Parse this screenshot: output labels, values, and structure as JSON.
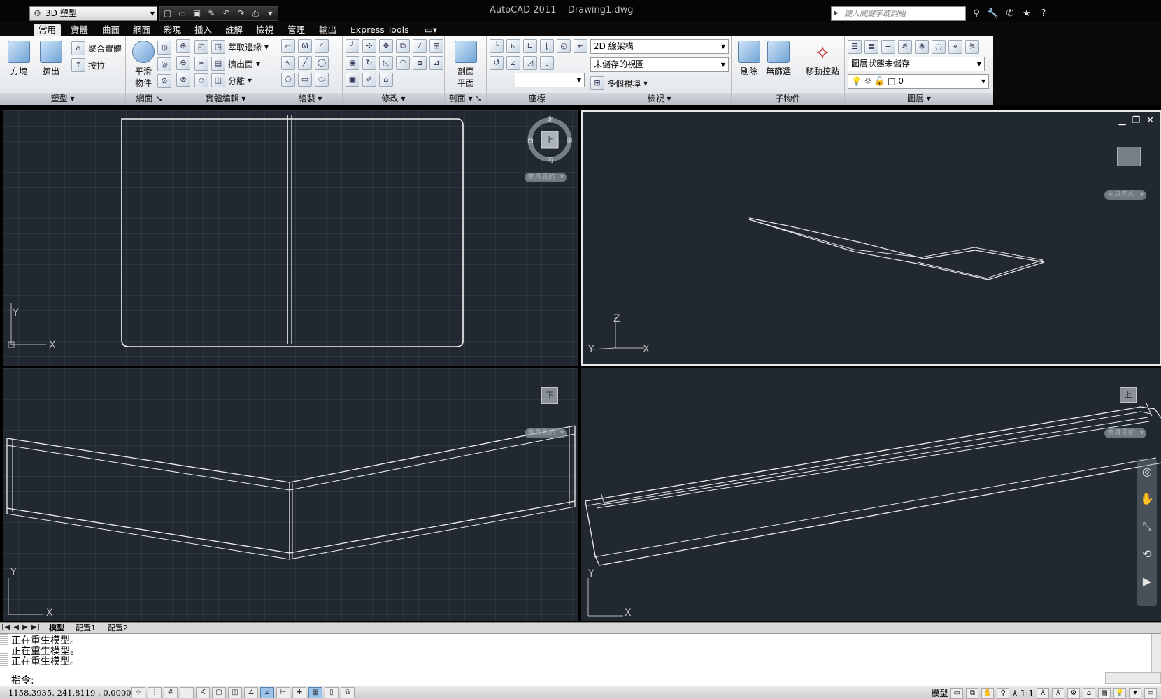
{
  "title_bar": {
    "workspace": "3D 塑型",
    "app_title": "AutoCAD 2011",
    "doc_title": "Drawing1.dwg",
    "search_placeholder": "鍵入關鍵字或詞組"
  },
  "ribbon_tabs": [
    "常用",
    "實體",
    "曲面",
    "網面",
    "彩現",
    "插入",
    "註解",
    "檢視",
    "管理",
    "輸出",
    "Express Tools"
  ],
  "panels": {
    "modeling": {
      "title": "塑型",
      "box": "方塊",
      "extrude": "擠出",
      "polysolid": "聚合實體",
      "presspull": "按拉"
    },
    "mesh": {
      "title": "網面",
      "smooth": "平滑",
      "smooth2": "物件"
    },
    "solid_edit": {
      "title": "實體編輯",
      "extract_edges": "萃取邊緣",
      "extrude_faces": "擠出面",
      "separate": "分離"
    },
    "draw": {
      "title": "繪製"
    },
    "modify": {
      "title": "修改"
    },
    "section": {
      "title": "剖面",
      "plane1": "剖面",
      "plane2": "平面"
    },
    "coordinates": {
      "title": "座標"
    },
    "view": {
      "title": "檢視",
      "visual_style": "2D 線架構",
      "named_view": "未儲存的視圖",
      "viewports": "多個視埠"
    },
    "subobject": {
      "title": "子物件",
      "culling": "剔除",
      "no_filter": "無篩選",
      "gizmo": "移動控點"
    },
    "layers": {
      "title": "圖層",
      "layer_state": "圖層狀態未儲存",
      "current_layer": "0"
    }
  },
  "viewports": {
    "top_left": {
      "view_label": "未具名的",
      "compass": {
        "n": "北",
        "s": "南",
        "e": "東",
        "w": "西",
        "center": "上"
      },
      "ucs_x": "X",
      "ucs_y": "Y"
    },
    "top_right": {
      "view_label": "未具名的",
      "ucs_x": "X",
      "ucs_y": "Y",
      "ucs_z": "Z"
    },
    "bottom_left": {
      "view_label": "未具名的",
      "cube_label": "下",
      "ucs_x": "X",
      "ucs_y": "Y"
    },
    "bottom_right": {
      "view_label": "未具名的",
      "cube_label": "上",
      "ucs_x": "X",
      "ucs_y": "Y"
    }
  },
  "layout_tabs": [
    "模型",
    "配置1",
    "配置2"
  ],
  "command_line": {
    "history": [
      "正在重生模型。",
      "正在重生模型。",
      "正在重生模型。"
    ],
    "prompt": "指令:"
  },
  "status_bar": {
    "coordinates": "1158.3935, 241.8119 , 0.0000",
    "model_label": "模型",
    "scale": "1:1"
  },
  "colors": {
    "viewport_bg": "#212830",
    "ribbon_bg": "#e6e9ed",
    "active_tab": "#ececec"
  }
}
